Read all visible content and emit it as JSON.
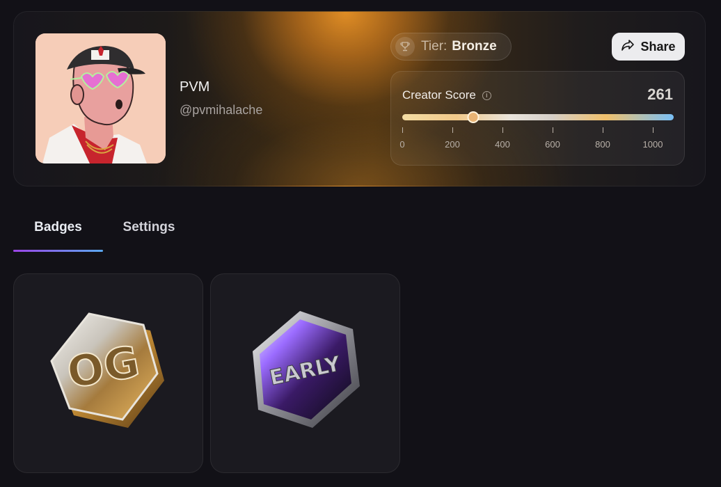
{
  "profile": {
    "name": "PVM",
    "handle": "@pvmihalache",
    "avatar_alt": "illustrated avatar",
    "tier_label": "Tier:",
    "tier_value": "Bronze",
    "share_label": "Share",
    "share_icon": "share-arrow-icon",
    "tier_icon": "trophy-icon"
  },
  "creator_score": {
    "title": "Creator Score",
    "value": "261",
    "value_num": 261,
    "max": 1000,
    "ticks": [
      "0",
      "200",
      "400",
      "600",
      "800",
      "1000"
    ]
  },
  "tabs": [
    {
      "label": "Badges",
      "active": true
    },
    {
      "label": "Settings",
      "active": false
    }
  ],
  "badges": [
    {
      "text": "OG",
      "style": "gold"
    },
    {
      "text": "EARLY",
      "style": "dark-purple"
    }
  ],
  "colors": {
    "background": "#121117",
    "accent_gold": "#e8922a",
    "tab_gradient_start": "#9b44e6",
    "tab_gradient_end": "#5aa9f0"
  }
}
